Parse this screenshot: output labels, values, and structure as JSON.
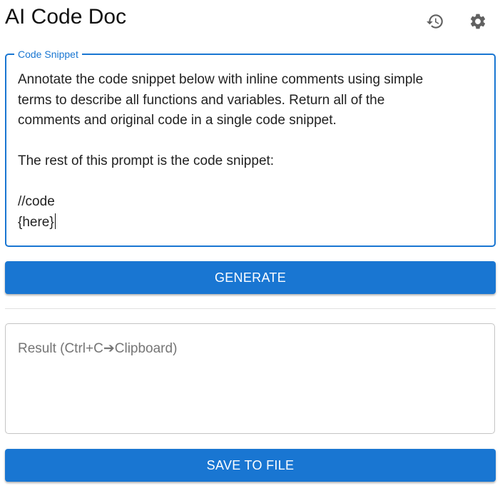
{
  "header": {
    "title": "AI Code Doc",
    "history_icon": "history-icon",
    "settings_icon": "gear-icon"
  },
  "snippet": {
    "label": "Code Snippet",
    "value": "Annotate the code snippet below with inline comments using simple\nterms to describe all functions and variables. Return all of the\ncomments and original code in a single code snippet.\n\nThe rest of this prompt is the code snippet:\n\n//code\n{here}"
  },
  "generate_button": {
    "label": "GENERATE"
  },
  "result": {
    "placeholder": "Result (Ctrl+C➔Clipboard)",
    "value": ""
  },
  "save_button": {
    "label": "SAVE TO FILE"
  },
  "colors": {
    "primary": "#1976d2",
    "icon": "#616161",
    "border": "#c4c4c4"
  }
}
